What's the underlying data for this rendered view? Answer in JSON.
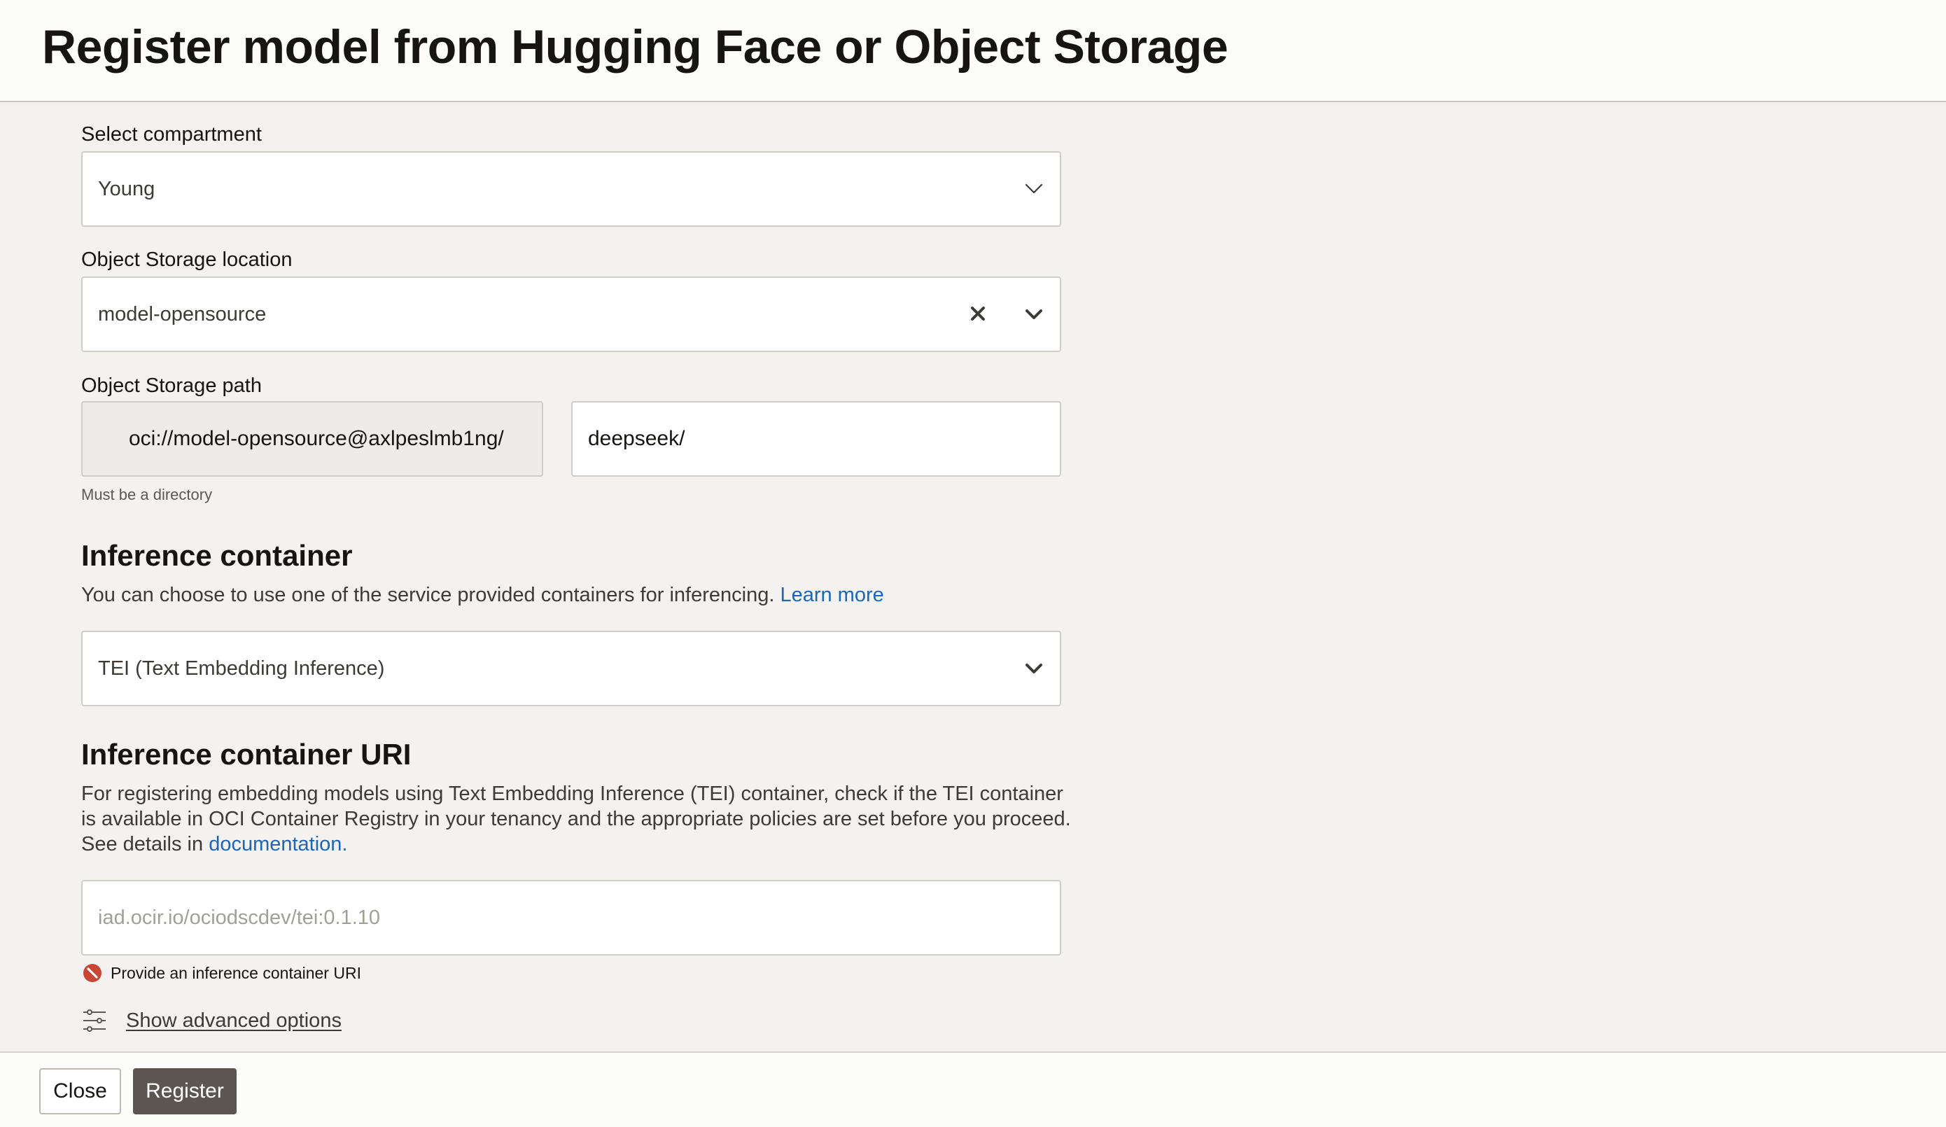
{
  "dialog": {
    "title": "Register model from Hugging Face or Object Storage"
  },
  "compartment": {
    "label": "Select compartment",
    "value": "Young",
    "icon": "chevron-down-icon"
  },
  "storage_location": {
    "label": "Object Storage location",
    "value": "model-opensource",
    "clear_icon": "close-icon",
    "icon": "chevron-down-icon"
  },
  "storage_path": {
    "label": "Object Storage path",
    "prefix": "oci://model-opensource@axlpeslmb1ng/",
    "value": "deepseek/",
    "hint": "Must be a directory"
  },
  "inference_container": {
    "title": "Inference container",
    "description": "You can choose to use one of the service provided containers for inferencing.",
    "learn_more": "Learn more",
    "value": "TEI (Text Embedding Inference)",
    "icon": "chevron-down-icon"
  },
  "container_uri": {
    "title": "Inference container URI",
    "description": "For registering embedding models using Text Embedding Inference (TEI) container, check if the TEI container is available in OCI Container Registry in your tenancy and the appropriate policies are set before you proceed. See details in",
    "doc_link": "documentation",
    "doc_suffix": ".",
    "placeholder": "iad.ocir.io/ociodscdev/tei:0.1.10",
    "error": "Provide an inference container URI",
    "error_icon": "error-icon",
    "error_color": "#c74634"
  },
  "advanced": {
    "label": "Show advanced options",
    "icon": "sliders-icon"
  },
  "footer": {
    "close_label": "Close",
    "register_label": "Register"
  },
  "colors": {
    "link": "#1e66b5",
    "primary_button": "#5b5652",
    "background": "#f3f2f0"
  }
}
